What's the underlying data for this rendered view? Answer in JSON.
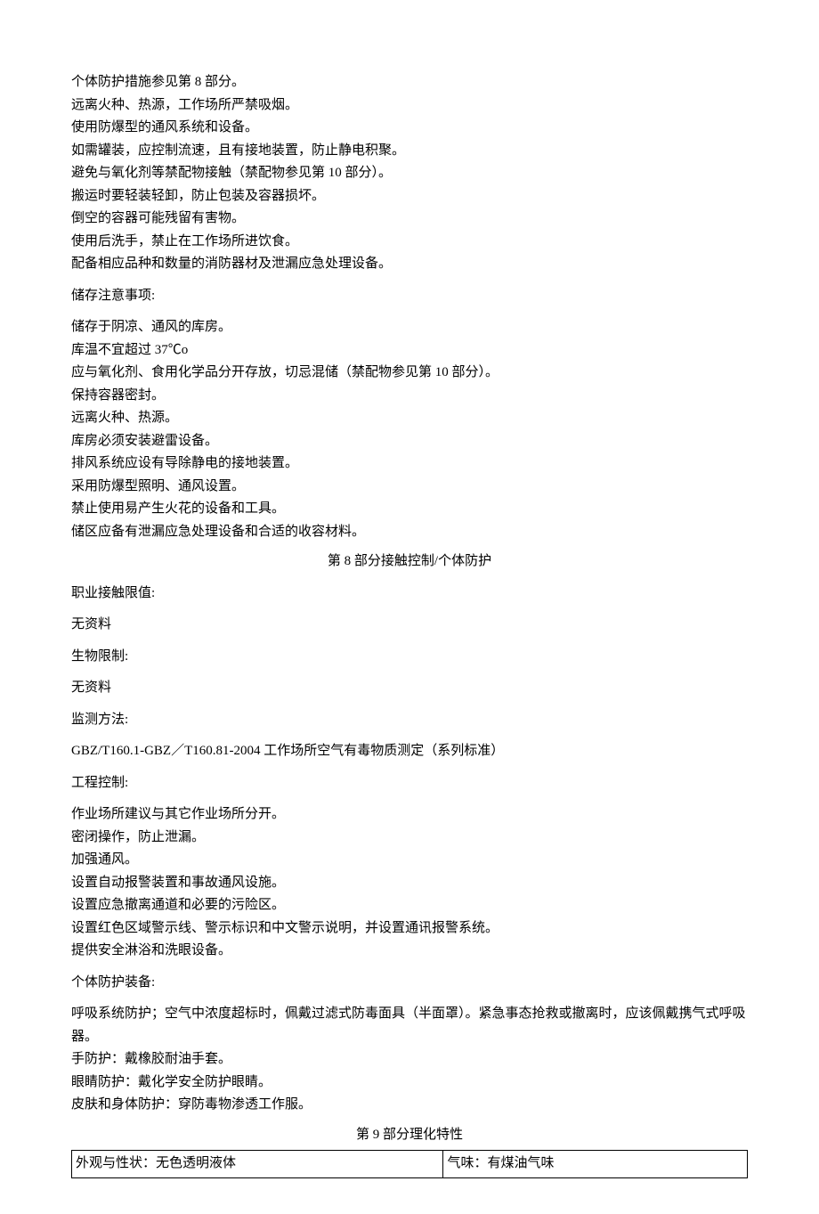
{
  "handling": {
    "lines": [
      "个体防护措施参见第 8 部分。",
      "远离火种、热源，工作场所严禁吸烟。",
      "使用防爆型的通风系统和设备。",
      "如需罐装，应控制流速，且有接地装置，防止静电积聚。",
      "避免与氧化剂等禁配物接触（禁配物参见第 10 部分）。",
      "搬运时要轻装轻卸，防止包装及容器损坏。",
      "倒空的容器可能残留有害物。",
      "使用后洗手，禁止在工作场所进饮食。",
      "配备相应品种和数量的消防器材及泄漏应急处理设备。"
    ]
  },
  "storage": {
    "heading": "储存注意事项:",
    "lines": [
      "储存于阴凉、通风的库房。",
      "库温不宜超过 37℃o",
      "应与氧化剂、食用化学品分开存放，切忌混储（禁配物参见第 10 部分）。",
      "保持容器密封。",
      "远离火种、热源。",
      "库房必须安装避雷设备。",
      "排风系统应设有导除静电的接地装置。",
      "采用防爆型照明、通风设置。",
      "禁止使用易产生火花的设备和工具。",
      "储区应备有泄漏应急处理设备和合适的收容材料。"
    ]
  },
  "section8": {
    "title": "第 8 部分接触控制/个体防护",
    "occ_limit_label": "职业接触限值:",
    "occ_limit_value": "无资料",
    "bio_limit_label": "生物限制:",
    "bio_limit_value": "无资料",
    "monitoring_label": "监测方法:",
    "monitoring_value": "GBZ/T160.1-GBZ／T160.81-2004 工作场所空气有毒物质测定（系列标准）",
    "eng_control_label": "工程控制:",
    "eng_control_lines": [
      "作业场所建议与其它作业场所分开。",
      "密闭操作，防止泄漏。",
      "加强通风。",
      "设置自动报警装置和事故通风设施。",
      "设置应急撤离通道和必要的污险区。",
      "设置红色区域警示线、警示标识和中文警示说明，并设置通讯报警系统。",
      "提供安全淋浴和洗眼设备。"
    ],
    "ppe_label": "个体防护装备:",
    "ppe_lines": [
      "呼吸系统防护；空气中浓度超标时，佩戴过滤式防毒面具（半面罩）。紧急事态抢救或撤离时，应该佩戴携气式呼吸器。",
      "手防护：戴橡胶耐油手套。",
      "眼睛防护：戴化学安全防护眼睛。",
      "皮肤和身体防护：穿防毒物渗透工作服。"
    ]
  },
  "section9": {
    "title": "第 9 部分理化特性",
    "row1_left": "外观与性状：无色透明液体",
    "row1_right": "气味：有煤油气味"
  }
}
